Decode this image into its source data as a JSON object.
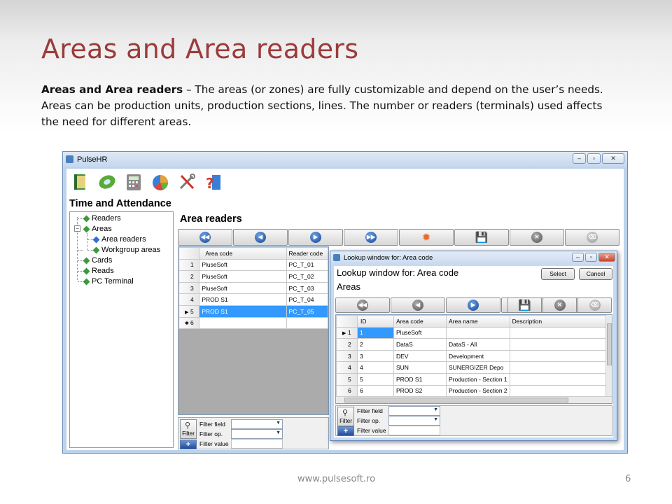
{
  "slide": {
    "title": "Areas and Area readers",
    "intro_bold": "Areas and Area readers",
    "intro_text": " – The areas (or zones) are fully customizable and depend on the user’s needs. Areas can be production units, production sections, lines. The number or readers (terminals) used affects the need for different areas.",
    "footer_url": "www.pulsesoft.ro",
    "page_number": "6"
  },
  "app": {
    "window_title": "PulseHR",
    "module_title": "Time and Attendance",
    "toolbar_icons": [
      "book-icon",
      "cd-icon",
      "calculator-icon",
      "pie-chart-icon",
      "tools-icon",
      "help-book-icon"
    ],
    "tree": {
      "readers": "Readers",
      "areas": "Areas",
      "area_readers": "Area readers",
      "workgroup_areas": "Workgroup areas",
      "cards": "Cards",
      "reads": "Reads",
      "pc_terminal": "PC Terminal"
    },
    "section_title": "Area readers",
    "grid": {
      "columns": [
        "Area code",
        "Reader code"
      ],
      "rows": [
        {
          "n": "1",
          "area": "PluseSoft",
          "reader": "PC_T_01"
        },
        {
          "n": "2",
          "area": "PluseSoft",
          "reader": "PC_T_02"
        },
        {
          "n": "3",
          "area": "PluseSoft",
          "reader": "PC_T_03"
        },
        {
          "n": "4",
          "area": "PROD S1",
          "reader": "PC_T_04"
        },
        {
          "n": "5",
          "area": "PROD S1",
          "reader": "PC_T_05"
        },
        {
          "n": "6",
          "area": "",
          "reader": ""
        }
      ],
      "selected_row": 5
    },
    "filter": {
      "button_label": "Filter",
      "field_label": "Filter field",
      "op_label": "Filter op.",
      "value_label": "Filter value"
    }
  },
  "dialog": {
    "window_title": "Lookup window for: Area code",
    "heading": "Lookup window for: Area code",
    "subheading": "Areas",
    "select_label": "Select",
    "cancel_label": "Cancel",
    "grid": {
      "columns": [
        "ID",
        "Area code",
        "Area name",
        "Description"
      ],
      "rows": [
        {
          "n": "1",
          "id": "1",
          "code": "PluseSoft",
          "name": "",
          "desc": ""
        },
        {
          "n": "2",
          "id": "2",
          "code": "DataS",
          "name": "DataS - All",
          "desc": ""
        },
        {
          "n": "3",
          "id": "3",
          "code": "DEV",
          "name": "Development",
          "desc": ""
        },
        {
          "n": "4",
          "id": "4",
          "code": "SUN",
          "name": "SUNERGIZER Depo",
          "desc": ""
        },
        {
          "n": "5",
          "id": "5",
          "code": "PROD S1",
          "name": "Production - Section 1",
          "desc": ""
        },
        {
          "n": "6",
          "id": "6",
          "code": "PROD S2",
          "name": "Production - Section 2",
          "desc": ""
        }
      ]
    },
    "filter": {
      "button_label": "Filter",
      "field_label": "Filter field",
      "op_label": "Filter op.",
      "value_label": "Filter value"
    }
  },
  "colors": {
    "title_red": "#9b3b3a",
    "selection_blue": "#3399ff",
    "window_frame": "#bcd3ec"
  }
}
